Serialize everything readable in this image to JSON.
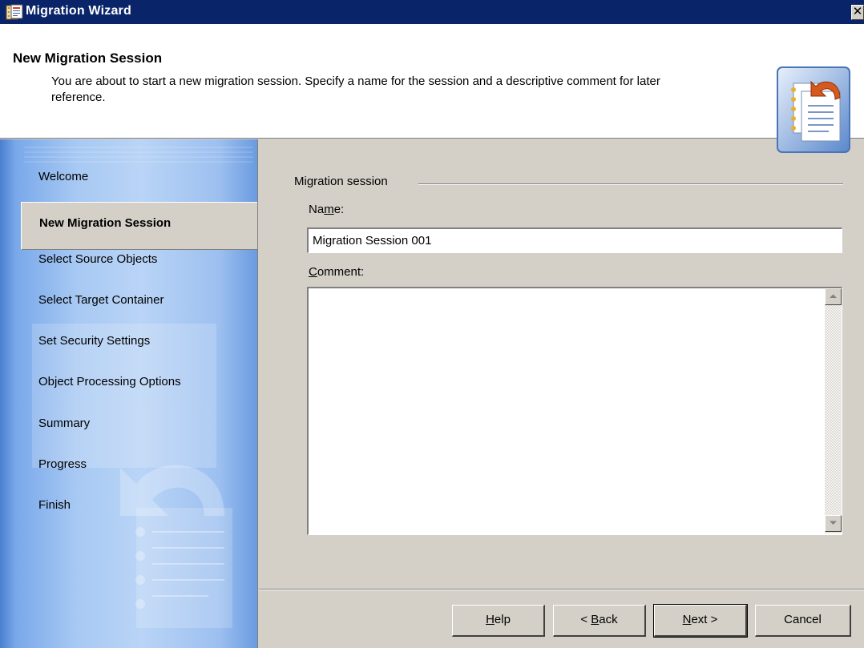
{
  "window": {
    "title": "Migration Wizard",
    "close_glyph": "✕",
    "icon": "migration-wizard-app-icon"
  },
  "header": {
    "title": "New Migration Session",
    "description": "You are about to start a new migration session. Specify a name for the session and a descriptive comment for later reference.",
    "icon": "migration-document-icon"
  },
  "sidebar": {
    "items": [
      {
        "label": "Welcome",
        "active": false
      },
      {
        "label": "New Migration Session",
        "active": true
      },
      {
        "label": "Select Source Objects",
        "active": false
      },
      {
        "label": "Select Target Container",
        "active": false
      },
      {
        "label": "Set Security Settings",
        "active": false
      },
      {
        "label": "Object Processing Options",
        "active": false
      },
      {
        "label": "Summary",
        "active": false
      },
      {
        "label": "Progress",
        "active": false
      },
      {
        "label": "Finish",
        "active": false
      }
    ]
  },
  "form": {
    "group_label": "Migration session",
    "name_label_pre": "Na",
    "name_label_accel": "m",
    "name_label_post": "e:",
    "name_value": "Migration Session 001",
    "comment_label_accel": "C",
    "comment_label_post": "omment:",
    "comment_value": ""
  },
  "buttons": {
    "help_accel": "H",
    "help_post": "elp",
    "back_pre": "< ",
    "back_accel": "B",
    "back_post": "ack",
    "next_accel": "N",
    "next_post": "ext >",
    "cancel": "Cancel"
  },
  "colors": {
    "titlebar": "#0a246a",
    "dialog_face": "#d4d0c8",
    "sidebar_blue": "#a8c9f3"
  }
}
